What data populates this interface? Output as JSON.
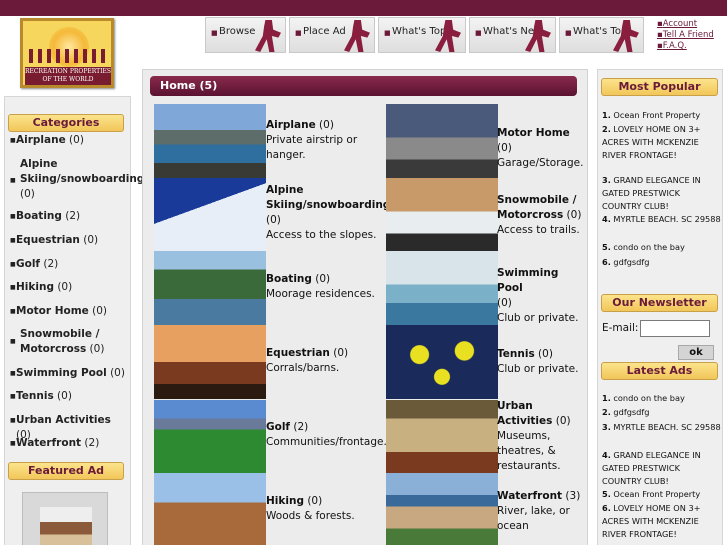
{
  "logo": {
    "text": "RECREATION PROPERTIES OF THE WORLD"
  },
  "nav": [
    {
      "label": "Browse"
    },
    {
      "label": "Place Ad"
    },
    {
      "label": "What's Top"
    },
    {
      "label": "What's New"
    },
    {
      "label": "What's Top"
    }
  ],
  "toplinks": [
    "Account",
    "Tell A Friend",
    "F.A.Q."
  ],
  "categories": {
    "title": "Categories",
    "items": [
      {
        "name": "Airplane",
        "count": "(0)"
      },
      {
        "name": "Alpine Skiing/snowboarding",
        "count": "(0)"
      },
      {
        "name": "Boating",
        "count": "(2)"
      },
      {
        "name": "Equestrian",
        "count": "(0)"
      },
      {
        "name": "Golf",
        "count": "(2)"
      },
      {
        "name": "Hiking",
        "count": "(0)"
      },
      {
        "name": "Motor Home",
        "count": "(0)"
      },
      {
        "name": "Snowmobile / Motorcross",
        "count": "(0)"
      },
      {
        "name": "Swimming Pool",
        "count": "(0)"
      },
      {
        "name": "Tennis",
        "count": "(0)"
      },
      {
        "name": "Urban Activities",
        "count": "(0)"
      },
      {
        "name": "Waterfront",
        "count": "(2)"
      }
    ]
  },
  "featured": {
    "title": "Featured Ad"
  },
  "main": {
    "title": "Home (5)",
    "left": [
      {
        "title": "Airplane",
        "count": "(0)",
        "desc": "Private airstrip or hanger."
      },
      {
        "title": "Alpine Skiing/snowboarding",
        "count": "(0)",
        "desc": "Access to the slopes."
      },
      {
        "title": "Boating",
        "count": "(0)",
        "desc": "Moorage residences."
      },
      {
        "title": "Equestrian",
        "count": "(0)",
        "desc": "Corrals/barns."
      },
      {
        "title": "Golf",
        "count": "(2)",
        "desc": "Communities/frontage."
      },
      {
        "title": "Hiking",
        "count": "(0)",
        "desc": "Woods & forests."
      }
    ],
    "right": [
      {
        "title": "Motor Home",
        "count": "(0)",
        "desc": "Garage/Storage."
      },
      {
        "title": "Snowmobile / Motorcross",
        "count": "(0)",
        "desc": "Access to trails."
      },
      {
        "title": "Swimming Pool",
        "count": "(0)",
        "desc": "Club or private."
      },
      {
        "title": "Tennis",
        "count": "(0)",
        "desc": "Club or private."
      },
      {
        "title": "Urban Activities",
        "count": "(0)",
        "desc": "Museums, theatres, & restaurants."
      },
      {
        "title": "Waterfront",
        "count": "(3)",
        "desc": "River, lake, or ocean"
      }
    ]
  },
  "popular": {
    "title": "Most Popular",
    "items": [
      {
        "n": "1.",
        "text": "Ocean Front Property"
      },
      {
        "n": "2.",
        "text": "LOVELY HOME ON 3+ ACRES WITH MCKENZIE RIVER FRONTAGE!"
      },
      {
        "n": "3.",
        "text": "GRAND ELEGANCE IN GATED PRESTWICK COUNTRY CLUB!"
      },
      {
        "n": "4.",
        "text": "MYRTLE BEACH. SC 29588"
      },
      {
        "n": "5.",
        "text": "condo on the bay"
      },
      {
        "n": "6.",
        "text": "gdfgsdfg"
      }
    ]
  },
  "newsletter": {
    "title": "Our Newsletter",
    "email_label": "E-mail:",
    "ok": "ok"
  },
  "latest": {
    "title": "Latest Ads",
    "items": [
      {
        "n": "1.",
        "text": "condo on the bay"
      },
      {
        "n": "2.",
        "text": "gdfgsdfg"
      },
      {
        "n": "3.",
        "text": "MYRTLE BEACH. SC 29588"
      },
      {
        "n": "4.",
        "text": "GRAND ELEGANCE IN GATED PRESTWICK COUNTRY CLUB!"
      },
      {
        "n": "5.",
        "text": "Ocean Front Property"
      },
      {
        "n": "6.",
        "text": "LOVELY HOME ON 3+ ACRES WITH MCKENZIE RIVER FRONTAGE!"
      }
    ]
  }
}
